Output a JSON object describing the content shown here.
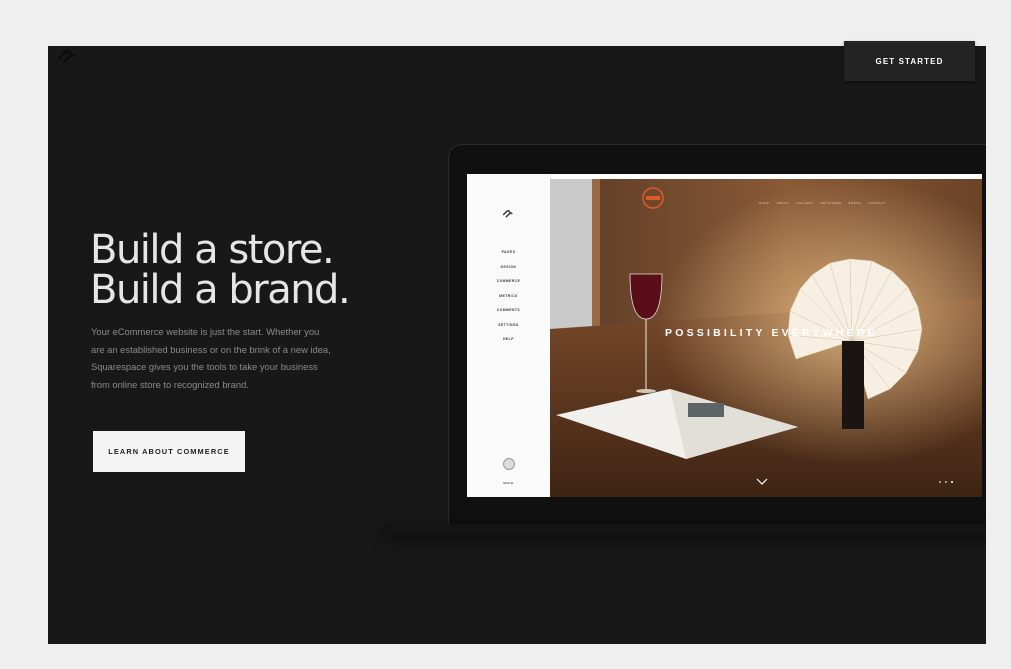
{
  "header": {
    "logo_icon": "squarespace-logo-icon",
    "cta_label": "GET STARTED"
  },
  "hero": {
    "title_line1": "Build a store.",
    "title_line2": "Build a brand.",
    "description": "Your eCommerce website is just the start. Whether you are an established business or on the brink of a new idea, Squarespace gives you the tools to take your business from online store to recognized brand.",
    "button_label": "LEARN ABOUT COMMERCE"
  },
  "laptop_screen": {
    "sidebar": {
      "logo_icon": "squarespace-logo-icon",
      "items": [
        "PAGES",
        "DESIGN",
        "COMMERCE",
        "METRICS",
        "COMMENTS",
        "SETTINGS",
        "HELP"
      ],
      "user_avatar_icon": "user-avatar-icon",
      "user_name": "MAX B."
    },
    "preview": {
      "nav_items": [
        "SHOP",
        "ABOUT",
        "GALLERY",
        "RETAILERS",
        "PRESS",
        "CONTACT"
      ],
      "headline": "POSSIBILITY EVERYWHERE",
      "chevron_icon": "chevron-down-icon"
    }
  },
  "colors": {
    "page_background": "#181818",
    "outer_background": "#efefef",
    "cta_background": "#232323",
    "button_light": "#f4f4f4",
    "brand_accent": "#e05a2b"
  }
}
